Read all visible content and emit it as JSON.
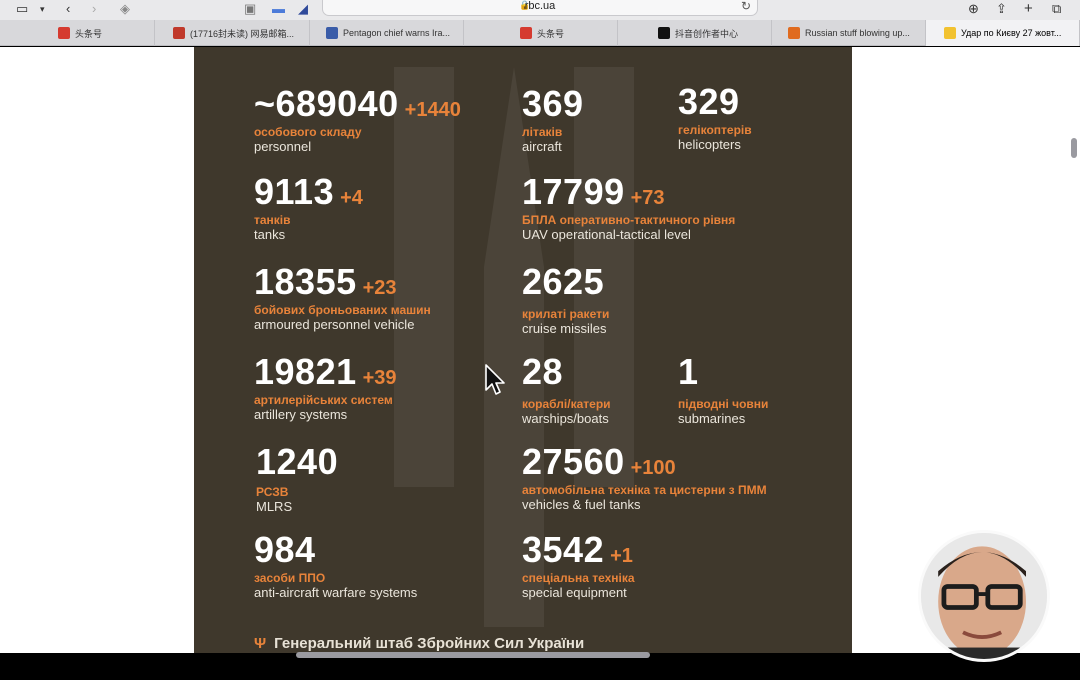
{
  "browser": {
    "url": "rbc.ua",
    "tabs": [
      {
        "label": "头条号",
        "fav": "#d53a2f"
      },
      {
        "label": "(17716封未读) 网易邮箱...",
        "fav": "#c0392b"
      },
      {
        "label": "Pentagon chief warns Ira...",
        "fav": "#3a5ca8"
      },
      {
        "label": "头条号",
        "fav": "#d53a2f"
      },
      {
        "label": "抖音创作者中心",
        "fav": "#111111"
      },
      {
        "label": "Russian stuff blowing up...",
        "fav": "#e06b1f"
      },
      {
        "label": "Удар по Києву 27 жовт...",
        "fav": "#f2c230"
      }
    ]
  },
  "stats": {
    "personnel": {
      "num": "~689040",
      "inc": "+1440",
      "ua": "особового складу",
      "en": "personnel"
    },
    "aircraft": {
      "num": "369",
      "ua": "літаків",
      "en": "aircraft"
    },
    "helicopters": {
      "num": "329",
      "ua": "гелікоптерів",
      "en": "helicopters"
    },
    "tanks": {
      "num": "9113",
      "inc": "+4",
      "ua": "танків",
      "en": "tanks"
    },
    "uav": {
      "num": "17799",
      "inc": "+73",
      "ua": "БПЛА оперативно-тактичного рівня",
      "en": "UAV operational-tactical level"
    },
    "apv": {
      "num": "18355",
      "inc": "+23",
      "ua": "бойових броньованих машин",
      "en": "armoured personnel vehicle"
    },
    "cruise": {
      "num": "2625",
      "ua": "крилаті ракети",
      "en": "cruise missiles"
    },
    "artillery": {
      "num": "19821",
      "inc": "+39",
      "ua": "артилерійських систем",
      "en": "artillery systems"
    },
    "warships": {
      "num": "28",
      "ua": "кораблі/катери",
      "en": "warships/boats"
    },
    "submarines": {
      "num": "1",
      "ua": "підводні човни",
      "en": "submarines"
    },
    "mlrs": {
      "num": "1240",
      "ua": "РСЗВ",
      "en": "MLRS"
    },
    "vehicles": {
      "num": "27560",
      "inc": "+100",
      "ua": "автомобільна техніка та цистерни з ПММ",
      "en": "vehicles & fuel tanks"
    },
    "aa": {
      "num": "984",
      "ua": "засоби ППО",
      "en": "anti-aircraft warfare systems"
    },
    "special": {
      "num": "3542",
      "inc": "+1",
      "ua": "спеціальна техніка",
      "en": "special equipment"
    }
  },
  "footer": {
    "text": "Генеральний штаб Збройних Сил України"
  }
}
